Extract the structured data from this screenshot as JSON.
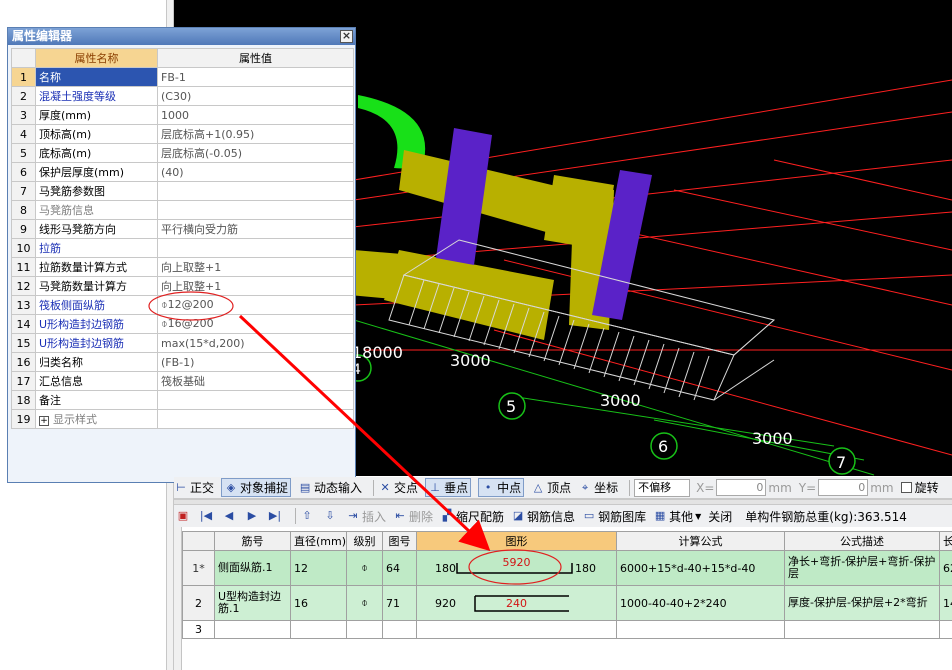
{
  "property_editor": {
    "title": "属性编辑器",
    "close_glyph": "×",
    "col_name": "属性名称",
    "col_value": "属性值",
    "rows": [
      {
        "idx": "1",
        "name": "名称",
        "value": "FB-1",
        "style": "sel"
      },
      {
        "idx": "2",
        "name": "混凝土强度等级",
        "value": "(C30)",
        "style": "blue"
      },
      {
        "idx": "3",
        "name": "厚度(mm)",
        "value": "1000",
        "style": ""
      },
      {
        "idx": "4",
        "name": "顶标高(m)",
        "value": "层底标高+1(0.95)",
        "style": ""
      },
      {
        "idx": "5",
        "name": "底标高(m)",
        "value": "层底标高(-0.05)",
        "style": ""
      },
      {
        "idx": "6",
        "name": "保护层厚度(mm)",
        "value": "(40)",
        "style": ""
      },
      {
        "idx": "7",
        "name": "马凳筋参数图",
        "value": "",
        "style": ""
      },
      {
        "idx": "8",
        "name": "马凳筋信息",
        "value": "",
        "style": "gray"
      },
      {
        "idx": "9",
        "name": "线形马凳筋方向",
        "value": "平行横向受力筋",
        "style": ""
      },
      {
        "idx": "10",
        "name": "拉筋",
        "value": "",
        "style": "blue"
      },
      {
        "idx": "11",
        "name": "拉筋数量计算方式",
        "value": "向上取整+1",
        "style": ""
      },
      {
        "idx": "12",
        "name": "马凳筋数量计算方",
        "value": "向上取整+1",
        "style": ""
      },
      {
        "idx": "13",
        "name": "筏板侧面纵筋",
        "value": "⌽12@200",
        "style": "blue"
      },
      {
        "idx": "14",
        "name": "U形构造封边钢筋",
        "value": "⌽16@200",
        "style": "blue"
      },
      {
        "idx": "15",
        "name": "U形构造封边钢筋",
        "value": "max(15*d,200)",
        "style": "blue"
      },
      {
        "idx": "16",
        "name": "归类名称",
        "value": "(FB-1)",
        "style": ""
      },
      {
        "idx": "17",
        "name": "汇总信息",
        "value": "筏板基础",
        "style": ""
      },
      {
        "idx": "18",
        "name": "备注",
        "value": "",
        "style": ""
      },
      {
        "idx": "19",
        "name": "显示样式",
        "value": "",
        "style": "gray",
        "expander": "+"
      }
    ]
  },
  "viewport": {
    "dims": [
      "18000",
      "3000",
      "3000",
      "3000"
    ],
    "axis_labels": [
      "4",
      "5",
      "6",
      "7"
    ],
    "colors": {
      "grid": "#ff2020",
      "slab": "#b8b000",
      "column": "#5a22c8",
      "green": "#18e018",
      "rebar": "#d8d8d8",
      "axis": "#18c018"
    }
  },
  "toolbar1": {
    "items": [
      "正交",
      "对象捕捉",
      "动态输入",
      "交点",
      "垂点",
      "中点",
      "顶点",
      "坐标",
      "不偏移",
      "X=",
      "0",
      "mm",
      "Y=",
      "0",
      "mm",
      "旋转"
    ]
  },
  "toolbar2": {
    "insert": "插入",
    "delete": "删除",
    "ruler": "缩尺配筋",
    "rebar_info": "钢筋信息",
    "rebar_lib": "钢筋图库",
    "other": "其他",
    "close": "关闭",
    "total_label": "单构件钢筋总重(kg):363.514"
  },
  "rebar_grid": {
    "headers": [
      "筋号",
      "直径(mm)",
      "级别",
      "图号",
      "图形",
      "计算公式",
      "公式描述",
      "长"
    ],
    "rows": [
      {
        "no": "1*",
        "name": "侧面纵筋.1",
        "dia": "12",
        "grade": "⌽",
        "fig": "64",
        "shape_left": "180",
        "shape_mid": "5920",
        "shape_right": "180",
        "formula": "6000+15*d-40+15*d-40",
        "desc": "净长+弯折-保护层+弯折-保护层",
        "len": "62"
      },
      {
        "no": "2",
        "name": "U型构造封边筋.1",
        "dia": "16",
        "grade": "⌽",
        "fig": "71",
        "shape_left": "920",
        "shape_mid": "240",
        "shape_right": "",
        "formula": "1000-40-40+2*240",
        "desc": "厚度-保护层-保护层+2*弯折",
        "len": "14"
      },
      {
        "no": "3",
        "name": "",
        "dia": "",
        "grade": "",
        "fig": "",
        "shape_left": "",
        "shape_mid": "",
        "shape_right": "",
        "formula": "",
        "desc": "",
        "len": ""
      }
    ]
  }
}
